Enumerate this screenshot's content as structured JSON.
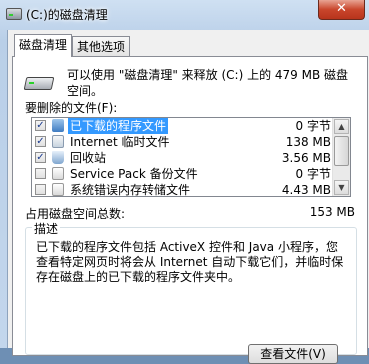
{
  "window": {
    "title": "(C:)的磁盘清理",
    "close_glyph": "✕",
    "icon": "drive-icon"
  },
  "tabs": [
    {
      "label": "磁盘清理",
      "active": true
    },
    {
      "label": "其他选项",
      "active": false
    }
  ],
  "summary": {
    "text": "可以使用 \"磁盘清理\" 来释放  (C:) 上的 479 MB 磁盘空间。",
    "icon": "hard-drive-icon"
  },
  "files_label": "要删除的文件(F):",
  "files": [
    {
      "name": "已下载的程序文件",
      "size": "0 字节",
      "checked": true,
      "selected": true,
      "icon": "program-folder-icon"
    },
    {
      "name": "Internet 临时文件",
      "size": "138 MB",
      "checked": true,
      "selected": false,
      "icon": "internet-files-icon"
    },
    {
      "name": "回收站",
      "size": "3.56 MB",
      "checked": true,
      "selected": false,
      "icon": "recycle-bin-icon"
    },
    {
      "name": "Service Pack 备份文件",
      "size": "0 字节",
      "checked": false,
      "selected": false,
      "icon": "backup-files-icon"
    },
    {
      "name": "系统错误内存转储文件",
      "size": "4.43 MB",
      "checked": false,
      "selected": false,
      "icon": "memory-dump-icon"
    }
  ],
  "total": {
    "label": "占用磁盘空间总数:",
    "value": "153 MB"
  },
  "description": {
    "title": "描述",
    "text": "已下载的程序文件包括 ActiveX 控件和 Java 小程序，您查看特定网页时将会从 Internet 自动下载它们，并临时保存在磁盘上的已下载的程序文件夹中。"
  },
  "buttons": {
    "view_files": "查看文件(V)"
  },
  "colors": {
    "selection": "#3399ff",
    "close_button": "#c9462c",
    "title_gradient_top": "#cfe0f2"
  }
}
